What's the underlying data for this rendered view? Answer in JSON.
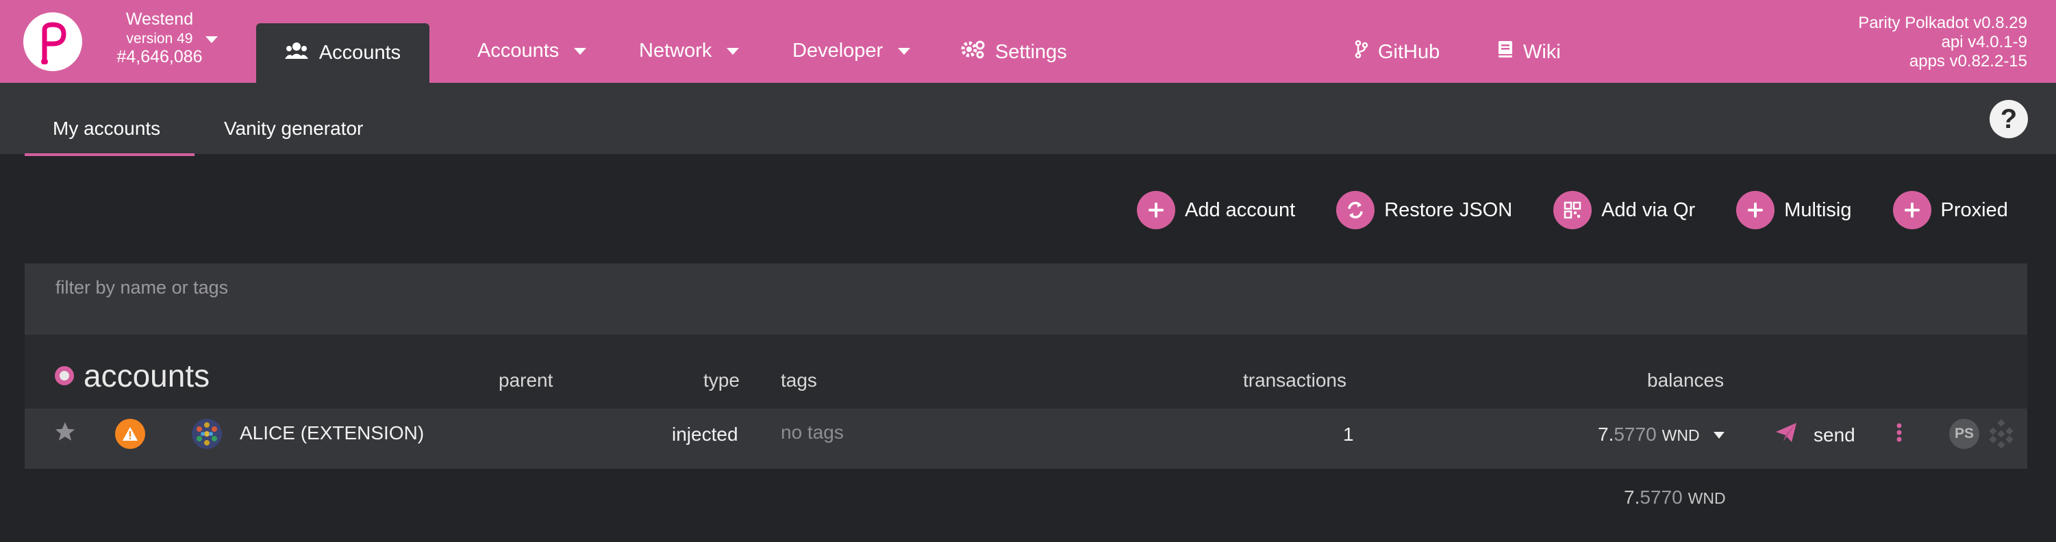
{
  "header": {
    "chain_name": "Westend",
    "chain_version": "version 49",
    "block_number": "#4,646,086",
    "active_tab": "Accounts",
    "nav": [
      "Accounts",
      "Network",
      "Developer",
      "Settings",
      "GitHub",
      "Wiki"
    ],
    "versions": [
      "Parity Polkadot v0.8.29",
      "api v4.0.1-9",
      "apps v0.82.2-15"
    ]
  },
  "subtabs": [
    "My accounts",
    "Vanity generator"
  ],
  "help_label": "?",
  "actions": [
    "Add account",
    "Restore JSON",
    "Add via Qr",
    "Multisig",
    "Proxied"
  ],
  "filter": {
    "placeholder": "filter by name or tags",
    "value": ""
  },
  "table": {
    "title": "accounts",
    "columns": {
      "parent": "parent",
      "type": "type",
      "tags": "tags",
      "transactions": "transactions",
      "balances": "balances"
    },
    "rows": [
      {
        "name": "ALICE (EXTENSION)",
        "type": "injected",
        "tags": "no tags",
        "transactions": "1",
        "balance_int": "7.",
        "balance_dec": "5770",
        "balance_unit": "WND",
        "send_label": "send",
        "initials": "PS"
      }
    ],
    "total": {
      "int": "7.",
      "dec": "5770",
      "unit": "WND"
    }
  },
  "colors": {
    "brand": "#d6609f",
    "header_bg": "#d6609f",
    "surface": "#36373b",
    "background": "#232427",
    "warning": "#f5861f"
  },
  "icons": [
    "polkadot-logo-icon",
    "users-icon",
    "gear-icon",
    "git-branch-icon",
    "book-icon",
    "question-icon",
    "plus-icon",
    "sync-icon",
    "qr-icon",
    "star-icon",
    "warning-icon",
    "identicon",
    "paper-plane-icon",
    "kebab-menu-icon",
    "qr-pattern-icon"
  ]
}
